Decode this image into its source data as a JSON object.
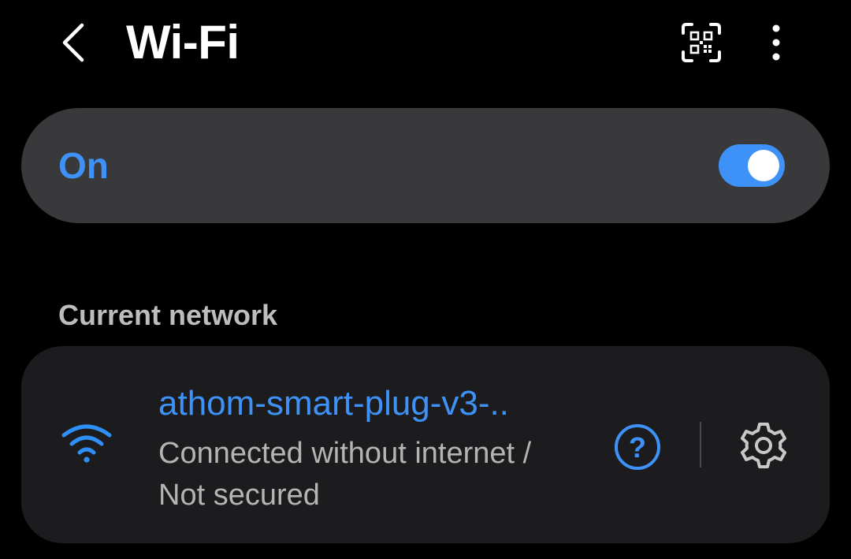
{
  "header": {
    "title": "Wi-Fi",
    "back_icon": "chevron-left-icon",
    "qr_icon": "qr-scan-icon",
    "more_icon": "more-vertical-icon"
  },
  "master_toggle": {
    "label": "On",
    "state": "on"
  },
  "current_network": {
    "section_title": "Current network",
    "name": "athom-smart-plug-v3-..",
    "status_line1": "Connected without internet /",
    "status_line2": "Not secured",
    "signal_icon": "wifi-signal-icon",
    "help_icon": "help-circle-icon",
    "settings_icon": "gear-icon"
  },
  "colors": {
    "accent": "#3e91f7",
    "background": "#000000",
    "toggle_card": "#39393b",
    "network_card": "#1c1c1e",
    "secondary_text": "#b4b4b4"
  }
}
